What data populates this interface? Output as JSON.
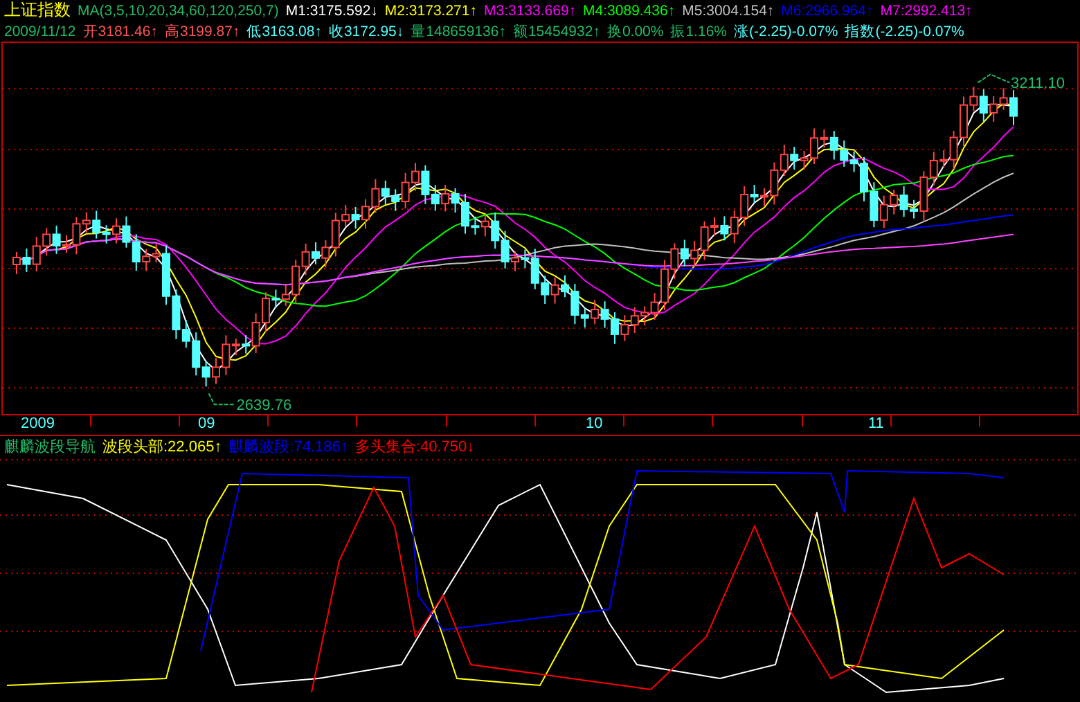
{
  "title": "上证指数",
  "ma_label": "MA(3,5,10,20,34,60,120,250,7)",
  "ma_values": [
    {
      "label": "M1:3175.592",
      "arrow": "↓",
      "color": "#ffffff"
    },
    {
      "label": "M2:3173.271",
      "arrow": "↑",
      "color": "#ffff00"
    },
    {
      "label": "M3:3133.669",
      "arrow": "↑",
      "color": "#ff00ff"
    },
    {
      "label": "M4:3089.436",
      "arrow": "↑",
      "color": "#00ff00"
    },
    {
      "label": "M5:3004.154",
      "arrow": "↑",
      "color": "#c0c0c0"
    },
    {
      "label": "M6:2966.964",
      "arrow": "↑",
      "color": "#0000ff"
    },
    {
      "label": "M7:2992.413",
      "arrow": "↑",
      "color": "#ff00ff"
    }
  ],
  "quote_line": [
    {
      "label": "2009/11/12",
      "color": "#22bb66"
    },
    {
      "label": "开3181.46",
      "arrow": "↑",
      "color": "#ff5555"
    },
    {
      "label": "高3199.87",
      "arrow": "↑",
      "color": "#ff5555"
    },
    {
      "label": "低3163.08",
      "arrow": "↑",
      "color": "#55ffff"
    },
    {
      "label": "收3172.95",
      "arrow": "↓",
      "color": "#55ffff"
    },
    {
      "label": "量148659136",
      "arrow": "↑",
      "color": "#22bb66"
    },
    {
      "label": "额15454932",
      "arrow": "↑",
      "color": "#22bb66"
    },
    {
      "label": "换0.00%",
      "color": "#22bb66"
    },
    {
      "label": "振1.16%",
      "color": "#22bb66"
    },
    {
      "label": "涨(-2.25)-0.07%",
      "color": "#55ffff"
    },
    {
      "label": "指数(-2.25)-0.07%",
      "color": "#55ffff"
    }
  ],
  "price_chart": {
    "high_label": "3211.10",
    "low_label": "2639.76"
  },
  "time_axis": [
    {
      "label": "2009"
    },
    {
      "label": "09"
    },
    {
      "label": "10"
    },
    {
      "label": "11"
    }
  ],
  "indicator": {
    "name": "麒麟波段导航",
    "values": [
      {
        "label": "波段头部:22.065",
        "arrow": "↑",
        "color": "#ffff00"
      },
      {
        "label": "麒麟波段:74.186",
        "arrow": "↑",
        "color": "#0000ff"
      },
      {
        "label": "多头集合:40.750",
        "arrow": "↓",
        "color": "#ff0000"
      }
    ]
  }
}
